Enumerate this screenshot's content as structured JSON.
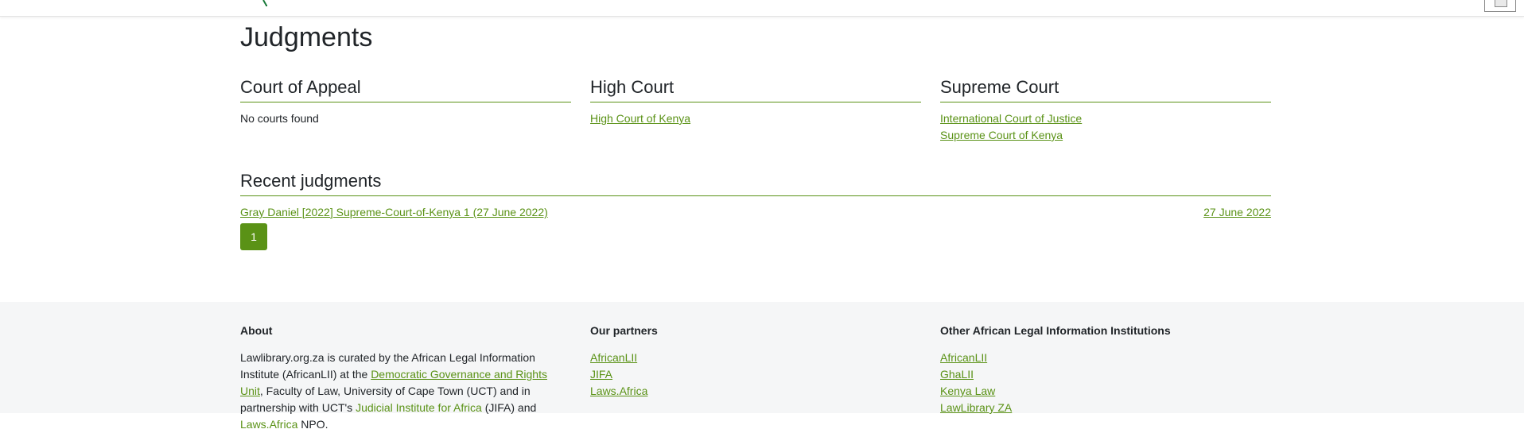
{
  "page": {
    "title": "Judgments"
  },
  "courts": [
    {
      "heading": "Court of Appeal",
      "empty_text": "No courts found",
      "links": []
    },
    {
      "heading": "High Court",
      "empty_text": "",
      "links": [
        "High Court of Kenya"
      ]
    },
    {
      "heading": "Supreme Court",
      "empty_text": "",
      "links": [
        "International Court of Justice",
        "Supreme Court of Kenya"
      ]
    }
  ],
  "recent": {
    "heading": "Recent judgments",
    "items": [
      {
        "title": "Gray Daniel [2022] Supreme-Court-of-Kenya 1 (27 June 2022)",
        "date": "27 June 2022"
      }
    ]
  },
  "pagination": {
    "current": "1"
  },
  "footer": {
    "about": {
      "heading": "About",
      "text_1": "Lawlibrary.org.za is curated by the African Legal Information Institute (AfricanLII) at the ",
      "link_1": "Democratic Governance and Rights Unit",
      "text_2": ", Faculty of Law, University of Cape Town (UCT) and in partnership with UCT's ",
      "link_2": "Judicial Institute for Africa",
      "text_3": " (JIFA) and ",
      "link_3": "Laws.Africa",
      "text_4": " NPO."
    },
    "partners": {
      "heading": "Our partners",
      "links": [
        "AfricanLII",
        "JIFA",
        "Laws.Africa"
      ]
    },
    "other": {
      "heading": "Other African Legal Information Institutions",
      "links": [
        "AfricanLII",
        "GhaLII",
        "Kenya Law",
        "LawLibrary ZA"
      ]
    }
  },
  "colors": {
    "accent": "#5a9216",
    "footer_bg": "#f5f6f7"
  }
}
